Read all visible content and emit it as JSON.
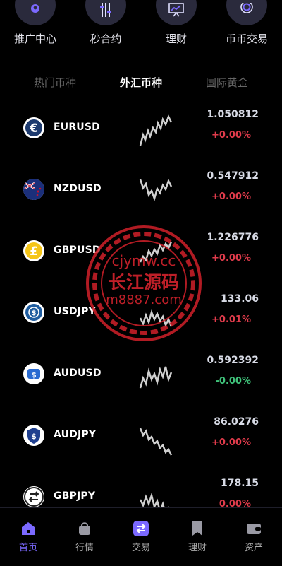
{
  "quick_actions": [
    {
      "label": "推广中心",
      "icon": "user-pin-icon"
    },
    {
      "label": "秒合约",
      "icon": "sliders-icon"
    },
    {
      "label": "理财",
      "icon": "chart-board-icon"
    },
    {
      "label": "币币交易",
      "icon": "coin-circle-icon"
    }
  ],
  "tabs": [
    {
      "label": "热门币种",
      "active": false
    },
    {
      "label": "外汇币种",
      "active": true
    },
    {
      "label": "国际黄金",
      "active": false
    }
  ],
  "markets": [
    {
      "symbol": "EURUSD",
      "price": "1.050812",
      "change": "+0.00%",
      "direction": "up",
      "icon": "euro-icon"
    },
    {
      "symbol": "NZDUSD",
      "price": "0.547912",
      "change": "+0.00%",
      "direction": "up",
      "icon": "nz-flag-icon"
    },
    {
      "symbol": "GBPUSD",
      "price": "1.226776",
      "change": "+0.00%",
      "direction": "up",
      "icon": "pound-icon"
    },
    {
      "symbol": "USDJPY",
      "price": "133.06",
      "change": "+0.01%",
      "direction": "up",
      "icon": "globe-coin-icon"
    },
    {
      "symbol": "AUDUSD",
      "price": "0.592392",
      "change": "-0.00%",
      "direction": "flat",
      "icon": "dollar-card-icon"
    },
    {
      "symbol": "AUDJPY",
      "price": "86.0276",
      "change": "+0.00%",
      "direction": "up",
      "icon": "dollar-shield-icon"
    },
    {
      "symbol": "GBPJPY",
      "price": "178.15",
      "change": "0.00%",
      "direction": "up",
      "icon": "exchange-arrows-icon"
    }
  ],
  "watermark": {
    "line1": "cjymw.cc",
    "line2": "长江源码",
    "line3": "m8887.com"
  },
  "bottom_nav": [
    {
      "label": "首页",
      "active": true,
      "icon": "home-icon"
    },
    {
      "label": "行情",
      "active": false,
      "icon": "bag-icon"
    },
    {
      "label": "交易",
      "active": false,
      "icon": "swap-icon"
    },
    {
      "label": "理财",
      "active": false,
      "icon": "bookmark-icon"
    },
    {
      "label": "资产",
      "active": false,
      "icon": "wallet-icon"
    }
  ],
  "colors": {
    "accent": "#7b69ff",
    "up": "#e03b4b",
    "down": "#3fc27a",
    "background": "#000000"
  }
}
